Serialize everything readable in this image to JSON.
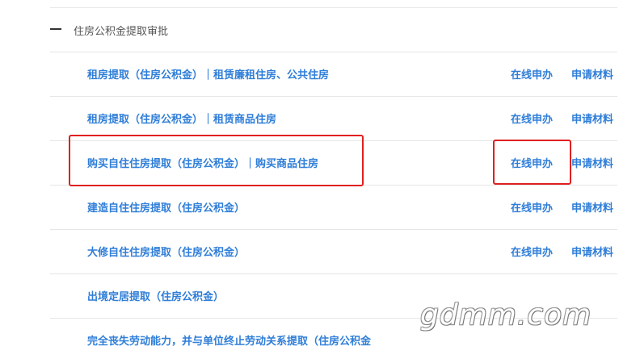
{
  "section": {
    "title": "住房公积金提取审批"
  },
  "items": [
    {
      "title": "租房提取（住房公积金）｜租赁廉租住房、公共住房",
      "apply": "在线申办",
      "materials": "申请材料"
    },
    {
      "title": "租房提取（住房公积金）｜租赁商品住房",
      "apply": "在线申办",
      "materials": "申请材料"
    },
    {
      "title": "购买自住住房提取（住房公积金）｜购买商品住房",
      "apply": "在线申办",
      "materials": "申请材料"
    },
    {
      "title": "建造自住住房提取（住房公积金）",
      "apply": "在线申办",
      "materials": "申请材料"
    },
    {
      "title": "大修自住住房提取（住房公积金）",
      "apply": "在线申办",
      "materials": "申请材料"
    },
    {
      "title": "出境定居提取（住房公积金）"
    },
    {
      "title": "完全丧失劳动能力，并与单位终止劳动关系提取（住房公积金"
    }
  ],
  "watermark": "gdmm.com",
  "colors": {
    "link": "#2f7ed8",
    "highlight": "#e02020",
    "divider": "#e6e6e6"
  }
}
